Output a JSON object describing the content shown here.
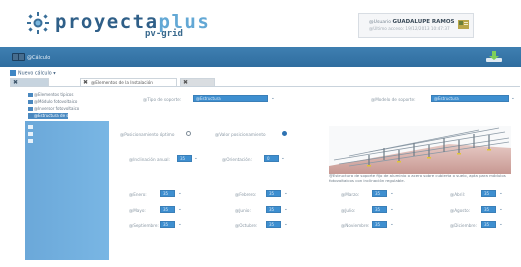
{
  "header": {
    "brand_main": "proyecta",
    "brand_plus": "plus",
    "brand_sub": "pv-grid",
    "user_prefix": "@Usuario",
    "user_name": "GUADALUPE RAMOS",
    "last_access": "@Último acceso: 19/12/2013 10:47:37"
  },
  "toolbar": {
    "calc_label": "@Cálculo"
  },
  "breadcrumb": {
    "label": "Nuevo cálculo"
  },
  "tabs": [
    {
      "label": "",
      "active": true
    },
    {
      "label": "@Elementos de la Instalación",
      "active": false
    },
    {
      "label": "",
      "active": false
    }
  ],
  "sidebar": {
    "top_items": [
      "@Elementos típicos",
      "@Módulo fotovoltaico",
      "@Inversor fotovoltaico",
      "@Estructura de soporte"
    ],
    "selected_index": 3
  },
  "form": {
    "tipo_label": "@Tipo de soporte:",
    "tipo_value": "@Estructura",
    "modelo_label": "@Modelo de soporte:",
    "modelo_value": "@Estructura",
    "opt_optimo": "@Posicionamiento óptimo",
    "opt_fijo": "@Valor posicionamiento",
    "selected_option": "fijo",
    "incl_label": "@Inclinación anual:",
    "incl_value": "35",
    "orient_label": "@Orientación:",
    "orient_value": "0"
  },
  "months": [
    {
      "label": "@Enero:",
      "value": "35"
    },
    {
      "label": "@Febrero:",
      "value": "35"
    },
    {
      "label": "@Marzo:",
      "value": "35"
    },
    {
      "label": "@Abril:",
      "value": "35"
    },
    {
      "label": "@Mayo:",
      "value": "35"
    },
    {
      "label": "@Junio:",
      "value": "35"
    },
    {
      "label": "@Julio:",
      "value": "35"
    },
    {
      "label": "@Agosto:",
      "value": "35"
    },
    {
      "label": "@Septiembre:",
      "value": "35"
    },
    {
      "label": "@Octubre:",
      "value": "35"
    },
    {
      "label": "@Noviembre:",
      "value": "35"
    },
    {
      "label": "@Diciembre:",
      "value": "35"
    }
  ],
  "caption": "@Estructura de soporte fijo de aluminio o acero sobre cubierta o suelo, apta para módulos fotovoltaicos con inclinación regulable.",
  "colors": {
    "brand_dark": "#2f5f88",
    "brand_light": "#63a8d5",
    "bar_blue": "#3572a5",
    "select_blue": "#3e8fd0",
    "sidebar_blue": "#72b0e0"
  }
}
